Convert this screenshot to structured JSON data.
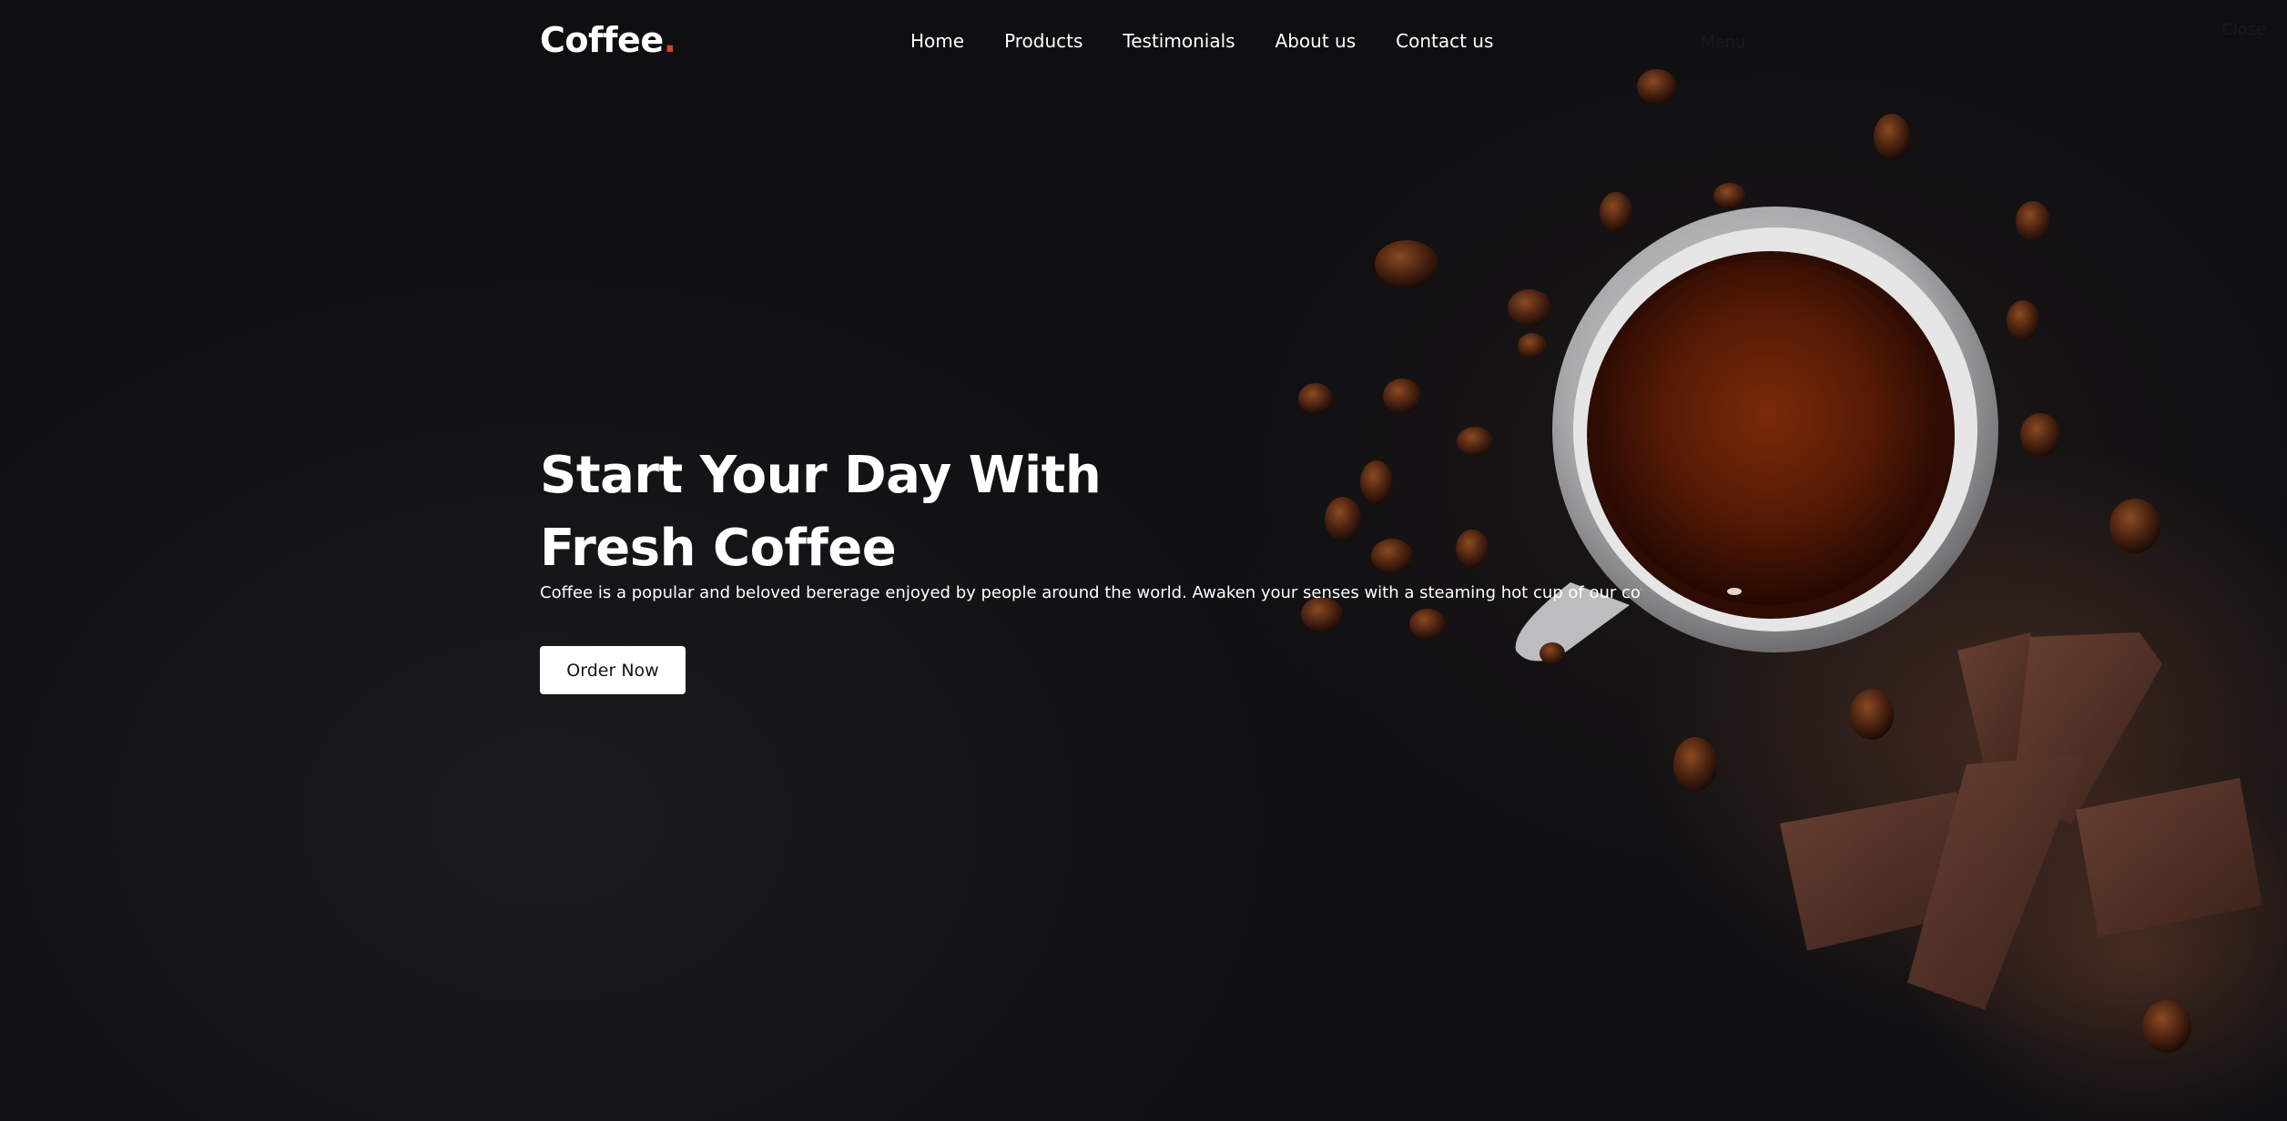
{
  "brand": {
    "name": "Coffee",
    "dot": ".",
    "dot_color": "#d2412d"
  },
  "nav": {
    "items": [
      {
        "label": "Home"
      },
      {
        "label": "Products"
      },
      {
        "label": "Testimonials"
      },
      {
        "label": "About us"
      },
      {
        "label": "Contact us"
      }
    ],
    "hidden_menu_label": "Menu",
    "hidden_close_label": "Close"
  },
  "hero": {
    "title_line1": "Start Your Day With",
    "title_line2": "Fresh Coffee",
    "description": "Coffee is a popular and beloved bererage enjoyed by people around the world. Awaken your senses with a steaming hot cup of our coffee",
    "cta_label": "Order Now"
  },
  "colors": {
    "background": "#131316",
    "text": "#ffffff",
    "button_bg": "#ffffff",
    "button_text": "#141414"
  },
  "decor": {
    "image": "coffee-cup-beans-chocolate"
  }
}
